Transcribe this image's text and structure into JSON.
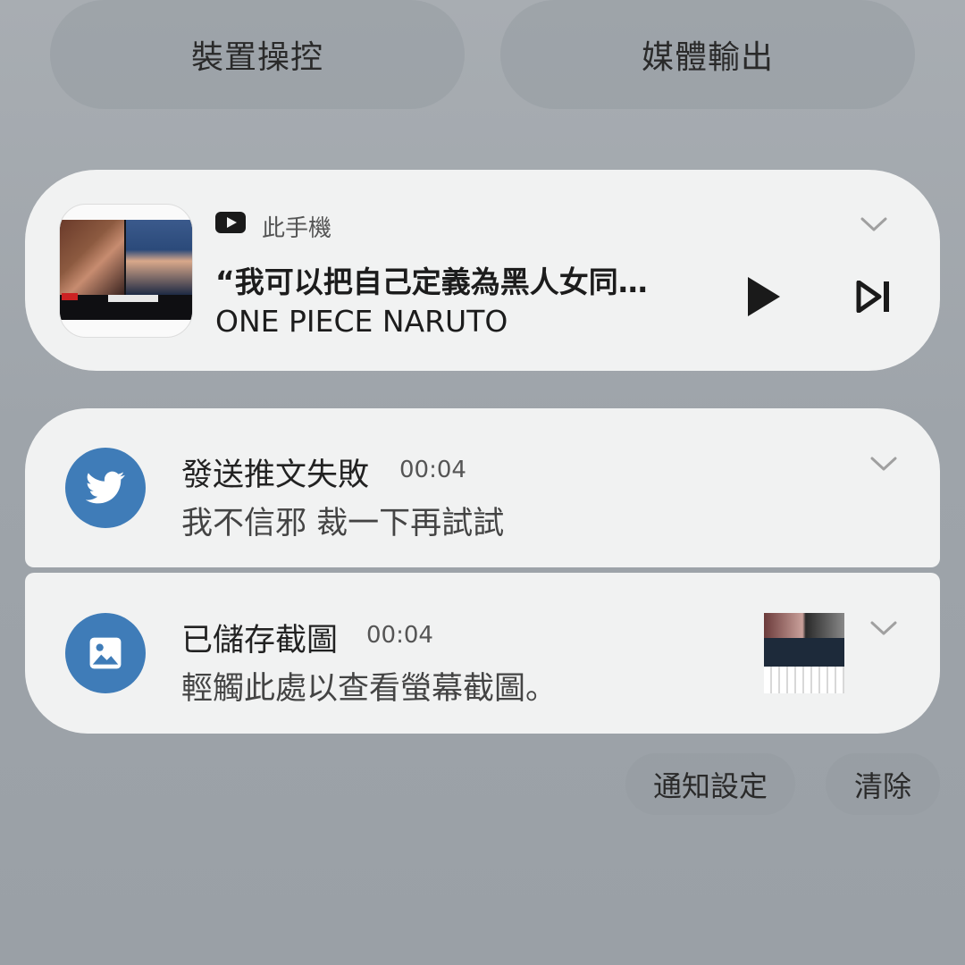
{
  "quick_buttons": {
    "device_control": "裝置操控",
    "media_output": "媒體輸出"
  },
  "media": {
    "source_icon": "youtube-icon",
    "source": "此手機",
    "title": "“我可以把自己定義為黑人女同…",
    "artist": "ONE PIECE NARUTO",
    "controls": [
      "play-icon",
      "skip-next-icon"
    ]
  },
  "notifications": [
    {
      "app_icon": "twitter-bird-icon",
      "title": "發送推文失敗",
      "time": "00:04",
      "body": "我不信邪 裁一下再試試"
    },
    {
      "app_icon": "gallery-image-icon",
      "title": "已儲存截圖",
      "time": "00:04",
      "body": "輕觸此處以查看螢幕截圖。"
    }
  ],
  "footer": {
    "settings": "通知設定",
    "clear": "清除"
  },
  "colors": {
    "app_icon_blue": "#3f7cb8",
    "card_bg": "#f1f2f2"
  }
}
